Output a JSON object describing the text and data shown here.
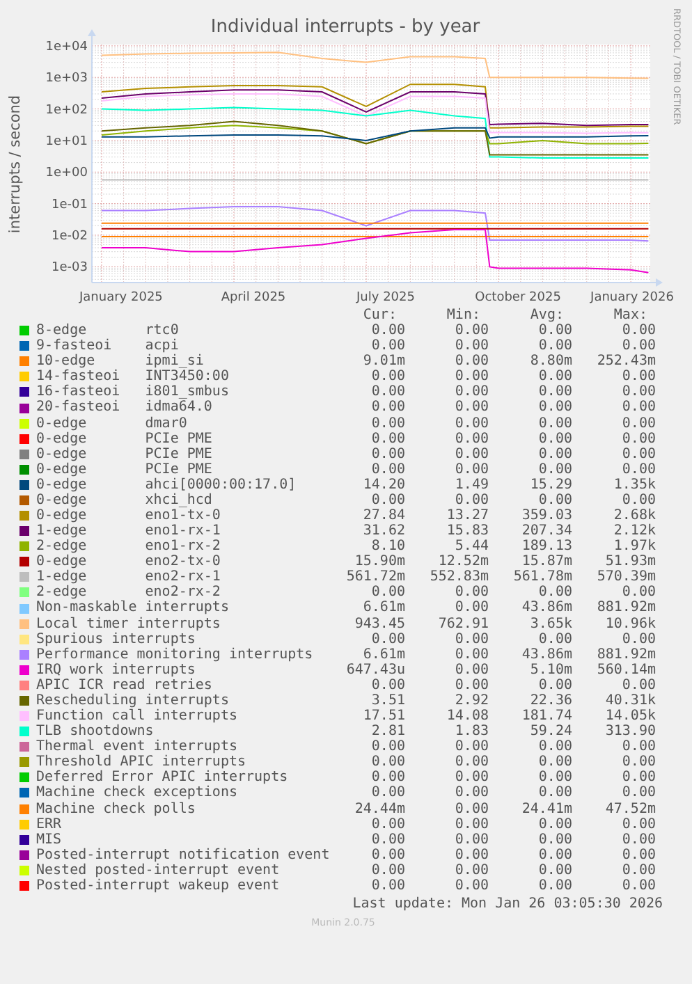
{
  "graph": {
    "title": "Individual interrupts - by year",
    "side_text": "RRDTOOL / TOBI OETIKER",
    "ylabel": "interrupts / second",
    "xticks": [
      "January 2025",
      "April 2025",
      "July 2025",
      "October 2025",
      "January 2026"
    ],
    "yticks": [
      "1e+04",
      "1e+03",
      "1e+02",
      "1e+01",
      "1e+00",
      "1e-01",
      "1e-02",
      "1e-03"
    ]
  },
  "legend": {
    "headers": [
      "Cur:",
      "Min:",
      "Avg:",
      "Max:"
    ],
    "rows": [
      {
        "name": "8-edge",
        "device": "rtc0",
        "color": "#00cc00",
        "cur": "0.00",
        "min": "0.00",
        "avg": "0.00",
        "max": "0.00"
      },
      {
        "name": "9-fasteoi",
        "device": "acpi",
        "color": "#0066b3",
        "cur": "0.00",
        "min": "0.00",
        "avg": "0.00",
        "max": "0.00"
      },
      {
        "name": "10-edge",
        "device": "ipmi_si",
        "color": "#ff8000",
        "cur": "9.01m",
        "min": "0.00",
        "avg": "8.80m",
        "max": "252.43m"
      },
      {
        "name": "14-fasteoi",
        "device": "INT3450:00",
        "color": "#ffcc00",
        "cur": "0.00",
        "min": "0.00",
        "avg": "0.00",
        "max": "0.00"
      },
      {
        "name": "16-fasteoi",
        "device": "i801_smbus",
        "color": "#330099",
        "cur": "0.00",
        "min": "0.00",
        "avg": "0.00",
        "max": "0.00"
      },
      {
        "name": "20-fasteoi",
        "device": "idma64.0",
        "color": "#990099",
        "cur": "0.00",
        "min": "0.00",
        "avg": "0.00",
        "max": "0.00"
      },
      {
        "name": "0-edge",
        "device": "dmar0",
        "color": "#ccff00",
        "cur": "0.00",
        "min": "0.00",
        "avg": "0.00",
        "max": "0.00"
      },
      {
        "name": "0-edge",
        "device": "PCIe PME",
        "color": "#ff0000",
        "cur": "0.00",
        "min": "0.00",
        "avg": "0.00",
        "max": "0.00"
      },
      {
        "name": "0-edge",
        "device": "PCIe PME",
        "color": "#808080",
        "cur": "0.00",
        "min": "0.00",
        "avg": "0.00",
        "max": "0.00"
      },
      {
        "name": "0-edge",
        "device": "PCIe PME",
        "color": "#008f00",
        "cur": "0.00",
        "min": "0.00",
        "avg": "0.00",
        "max": "0.00"
      },
      {
        "name": "0-edge",
        "device": "ahci[0000:00:17.0]",
        "color": "#00487d",
        "cur": "14.20",
        "min": "1.49",
        "avg": "15.29",
        "max": "1.35k"
      },
      {
        "name": "0-edge",
        "device": "xhci_hcd",
        "color": "#b35a00",
        "cur": "0.00",
        "min": "0.00",
        "avg": "0.00",
        "max": "0.00"
      },
      {
        "name": "0-edge",
        "device": "eno1-tx-0",
        "color": "#b38f00",
        "cur": "27.84",
        "min": "13.27",
        "avg": "359.03",
        "max": "2.68k"
      },
      {
        "name": "1-edge",
        "device": "eno1-rx-1",
        "color": "#6b006b",
        "cur": "31.62",
        "min": "15.83",
        "avg": "207.34",
        "max": "2.12k"
      },
      {
        "name": "2-edge",
        "device": "eno1-rx-2",
        "color": "#8fb300",
        "cur": "8.10",
        "min": "5.44",
        "avg": "189.13",
        "max": "1.97k"
      },
      {
        "name": "0-edge",
        "device": "eno2-tx-0",
        "color": "#b30000",
        "cur": "15.90m",
        "min": "12.52m",
        "avg": "15.87m",
        "max": "51.93m"
      },
      {
        "name": "1-edge",
        "device": "eno2-rx-1",
        "color": "#bebebe",
        "cur": "561.72m",
        "min": "552.83m",
        "avg": "561.78m",
        "max": "570.39m"
      },
      {
        "name": "2-edge",
        "device": "eno2-rx-2",
        "color": "#80ff80",
        "cur": "0.00",
        "min": "0.00",
        "avg": "0.00",
        "max": "0.00"
      },
      {
        "name": "Non-maskable interrupts",
        "color": "#80c9ff",
        "cur": "6.61m",
        "min": "0.00",
        "avg": "43.86m",
        "max": "881.92m"
      },
      {
        "name": "Local timer interrupts",
        "color": "#ffc080",
        "cur": "943.45",
        "min": "762.91",
        "avg": "3.65k",
        "max": "10.96k"
      },
      {
        "name": "Spurious interrupts",
        "color": "#ffe680",
        "cur": "0.00",
        "min": "0.00",
        "avg": "0.00",
        "max": "0.00"
      },
      {
        "name": "Performance monitoring interrupts",
        "color": "#aa80ff",
        "cur": "6.61m",
        "min": "0.00",
        "avg": "43.86m",
        "max": "881.92m"
      },
      {
        "name": "IRQ work interrupts",
        "color": "#ee00cc",
        "cur": "647.43u",
        "min": "0.00",
        "avg": "5.10m",
        "max": "560.14m"
      },
      {
        "name": "APIC ICR read retries",
        "color": "#ff8080",
        "cur": "0.00",
        "min": "0.00",
        "avg": "0.00",
        "max": "0.00"
      },
      {
        "name": "Rescheduling interrupts",
        "color": "#666600",
        "cur": "3.51",
        "min": "2.92",
        "avg": "22.36",
        "max": "40.31k"
      },
      {
        "name": "Function call interrupts",
        "color": "#ffbfff",
        "cur": "17.51",
        "min": "14.08",
        "avg": "181.74",
        "max": "14.05k"
      },
      {
        "name": "TLB shootdowns",
        "color": "#00ffcc",
        "cur": "2.81",
        "min": "1.83",
        "avg": "59.24",
        "max": "313.90"
      },
      {
        "name": "Thermal event interrupts",
        "color": "#cc6699",
        "cur": "0.00",
        "min": "0.00",
        "avg": "0.00",
        "max": "0.00"
      },
      {
        "name": "Threshold APIC interrupts",
        "color": "#999900",
        "cur": "0.00",
        "min": "0.00",
        "avg": "0.00",
        "max": "0.00"
      },
      {
        "name": "Deferred Error APIC interrupts",
        "color": "#00cc00",
        "cur": "0.00",
        "min": "0.00",
        "avg": "0.00",
        "max": "0.00"
      },
      {
        "name": "Machine check exceptions",
        "color": "#0066b3",
        "cur": "0.00",
        "min": "0.00",
        "avg": "0.00",
        "max": "0.00"
      },
      {
        "name": "Machine check polls",
        "color": "#ff8000",
        "cur": "24.44m",
        "min": "0.00",
        "avg": "24.41m",
        "max": "47.52m"
      },
      {
        "name": "ERR",
        "color": "#ffcc00",
        "cur": "0.00",
        "min": "0.00",
        "avg": "0.00",
        "max": "0.00"
      },
      {
        "name": "MIS",
        "color": "#330099",
        "cur": "0.00",
        "min": "0.00",
        "avg": "0.00",
        "max": "0.00"
      },
      {
        "name": "Posted-interrupt notification event",
        "color": "#990099",
        "cur": "0.00",
        "min": "0.00",
        "avg": "0.00",
        "max": "0.00"
      },
      {
        "name": "Nested posted-interrupt event",
        "color": "#ccff00",
        "cur": "0.00",
        "min": "0.00",
        "avg": "0.00",
        "max": "0.00"
      },
      {
        "name": "Posted-interrupt wakeup event",
        "color": "#ff0000",
        "cur": "0.00",
        "min": "0.00",
        "avg": "0.00",
        "max": "0.00"
      }
    ]
  },
  "last_update": "Last update: Mon Jan 26 03:05:30 2026",
  "version": "Munin 2.0.75"
}
